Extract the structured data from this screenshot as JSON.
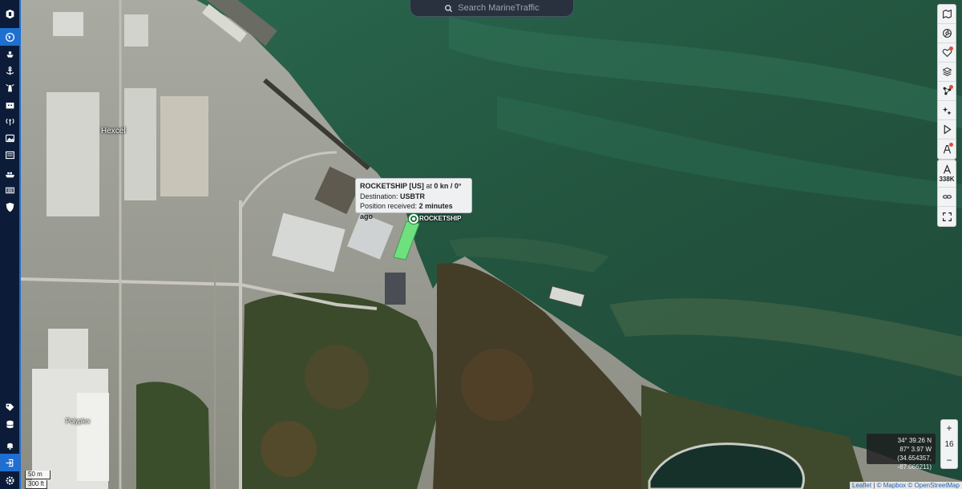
{
  "search": {
    "placeholder": "Search MarineTraffic",
    "icon": "search-icon"
  },
  "left_nav": {
    "items": [
      {
        "name": "logo",
        "icon": "marinetraffic-logo-icon"
      },
      {
        "name": "live-map",
        "icon": "globe-icon",
        "active": true
      },
      {
        "name": "vessels",
        "icon": "ship-icon"
      },
      {
        "name": "ports",
        "icon": "anchor-icon"
      },
      {
        "name": "lighthouses",
        "icon": "lighthouse-icon"
      },
      {
        "name": "fleets",
        "icon": "building-icon"
      },
      {
        "name": "stations",
        "icon": "antenna-icon"
      },
      {
        "name": "photos",
        "icon": "photo-icon"
      },
      {
        "name": "news",
        "icon": "newspaper-icon"
      },
      {
        "name": "sea-trade",
        "icon": "container-ship-icon"
      },
      {
        "name": "analytics",
        "icon": "barcode-icon"
      },
      {
        "name": "shield",
        "icon": "shield-icon"
      },
      {
        "name": "tags",
        "icon": "tag-icon"
      },
      {
        "name": "database",
        "icon": "database-icon"
      },
      {
        "name": "notifications",
        "icon": "bell-icon"
      },
      {
        "name": "login",
        "icon": "login-icon"
      },
      {
        "name": "settings",
        "icon": "gear-icon"
      }
    ]
  },
  "right_toolbar": {
    "tools": [
      {
        "name": "map-options",
        "icon": "map-icon"
      },
      {
        "name": "weather",
        "icon": "aperture-icon"
      },
      {
        "name": "filters",
        "icon": "heart-icon",
        "badge": true
      },
      {
        "name": "layers",
        "icon": "layers-icon"
      },
      {
        "name": "density",
        "icon": "network-icon",
        "badge": true
      },
      {
        "name": "measure",
        "icon": "sparkle-icon"
      },
      {
        "name": "play",
        "icon": "play-icon"
      },
      {
        "name": "route",
        "icon": "route-icon",
        "badge": true
      }
    ],
    "vessel_count": "338K"
  },
  "popup": {
    "vessel_name": "ROCKETSHIP [US]",
    "at": "at",
    "speed_course": "0 kn / 0°",
    "destination_label": "Destination:",
    "destination": "USBTR",
    "position_label": "Position received:",
    "position_time": "2 minutes ago"
  },
  "vessel_label": "ROCKETSHIP",
  "places": {
    "hexcel": "Hexcel",
    "polyplex": "Polyplex"
  },
  "coordinates": {
    "lat": "34° 39.26 N",
    "lon": "87° 3.97 W",
    "decimal": "(34.654357, -87.066211)"
  },
  "zoom": {
    "level": "16",
    "plus": "+",
    "minus": "−"
  },
  "scale": {
    "metric": "50 m",
    "imperial": "300 ft"
  },
  "attribution": {
    "leaflet": "Leaflet",
    "mapbox": "© Mapbox",
    "osm": "© OpenStreetMap"
  },
  "colors": {
    "nav_bg": "#0c1c38",
    "nav_accent": "#1f6fd1",
    "vessel": "#6fe07e",
    "water": "#22503f"
  }
}
